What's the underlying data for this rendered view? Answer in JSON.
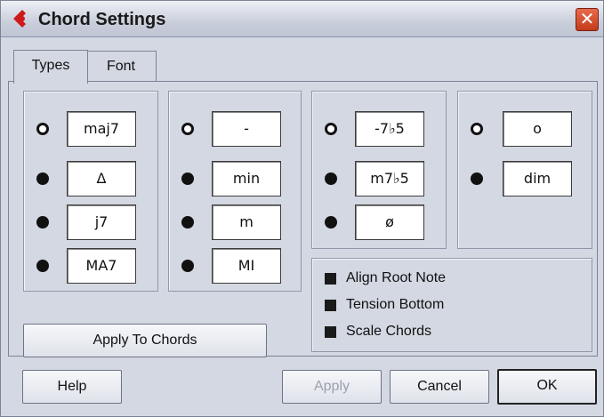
{
  "window": {
    "title": "Chord Settings",
    "close_glyph": "✕"
  },
  "tabs": [
    {
      "label": "Types",
      "active": true
    },
    {
      "label": "Font",
      "active": false
    }
  ],
  "groups": [
    {
      "options": [
        {
          "label": "maj7",
          "selected": true
        },
        {
          "label": "Δ",
          "selected": false
        },
        {
          "label": "j7",
          "selected": false
        },
        {
          "label": "MA7",
          "selected": false
        }
      ]
    },
    {
      "options": [
        {
          "label": "-",
          "selected": true
        },
        {
          "label": "min",
          "selected": false
        },
        {
          "label": "m",
          "selected": false
        },
        {
          "label": "MI",
          "selected": false
        }
      ]
    },
    {
      "options": [
        {
          "label": "-7♭5",
          "selected": true
        },
        {
          "label": "m7♭5",
          "selected": false
        },
        {
          "label": "ø",
          "selected": false
        }
      ]
    },
    {
      "options": [
        {
          "label": "o",
          "selected": true
        },
        {
          "label": "dim",
          "selected": false
        }
      ]
    }
  ],
  "checkboxes": [
    {
      "label": "Align Root Note",
      "checked": true
    },
    {
      "label": "Tension Bottom",
      "checked": true
    },
    {
      "label": "Scale Chords",
      "checked": true
    }
  ],
  "buttons": {
    "apply_to_chords": "Apply To Chords",
    "help": "Help",
    "apply": "Apply",
    "cancel": "Cancel",
    "ok": "OK"
  },
  "colors": {
    "close_red": "#d44a28",
    "app_icon_red": "#cc1a1a"
  }
}
